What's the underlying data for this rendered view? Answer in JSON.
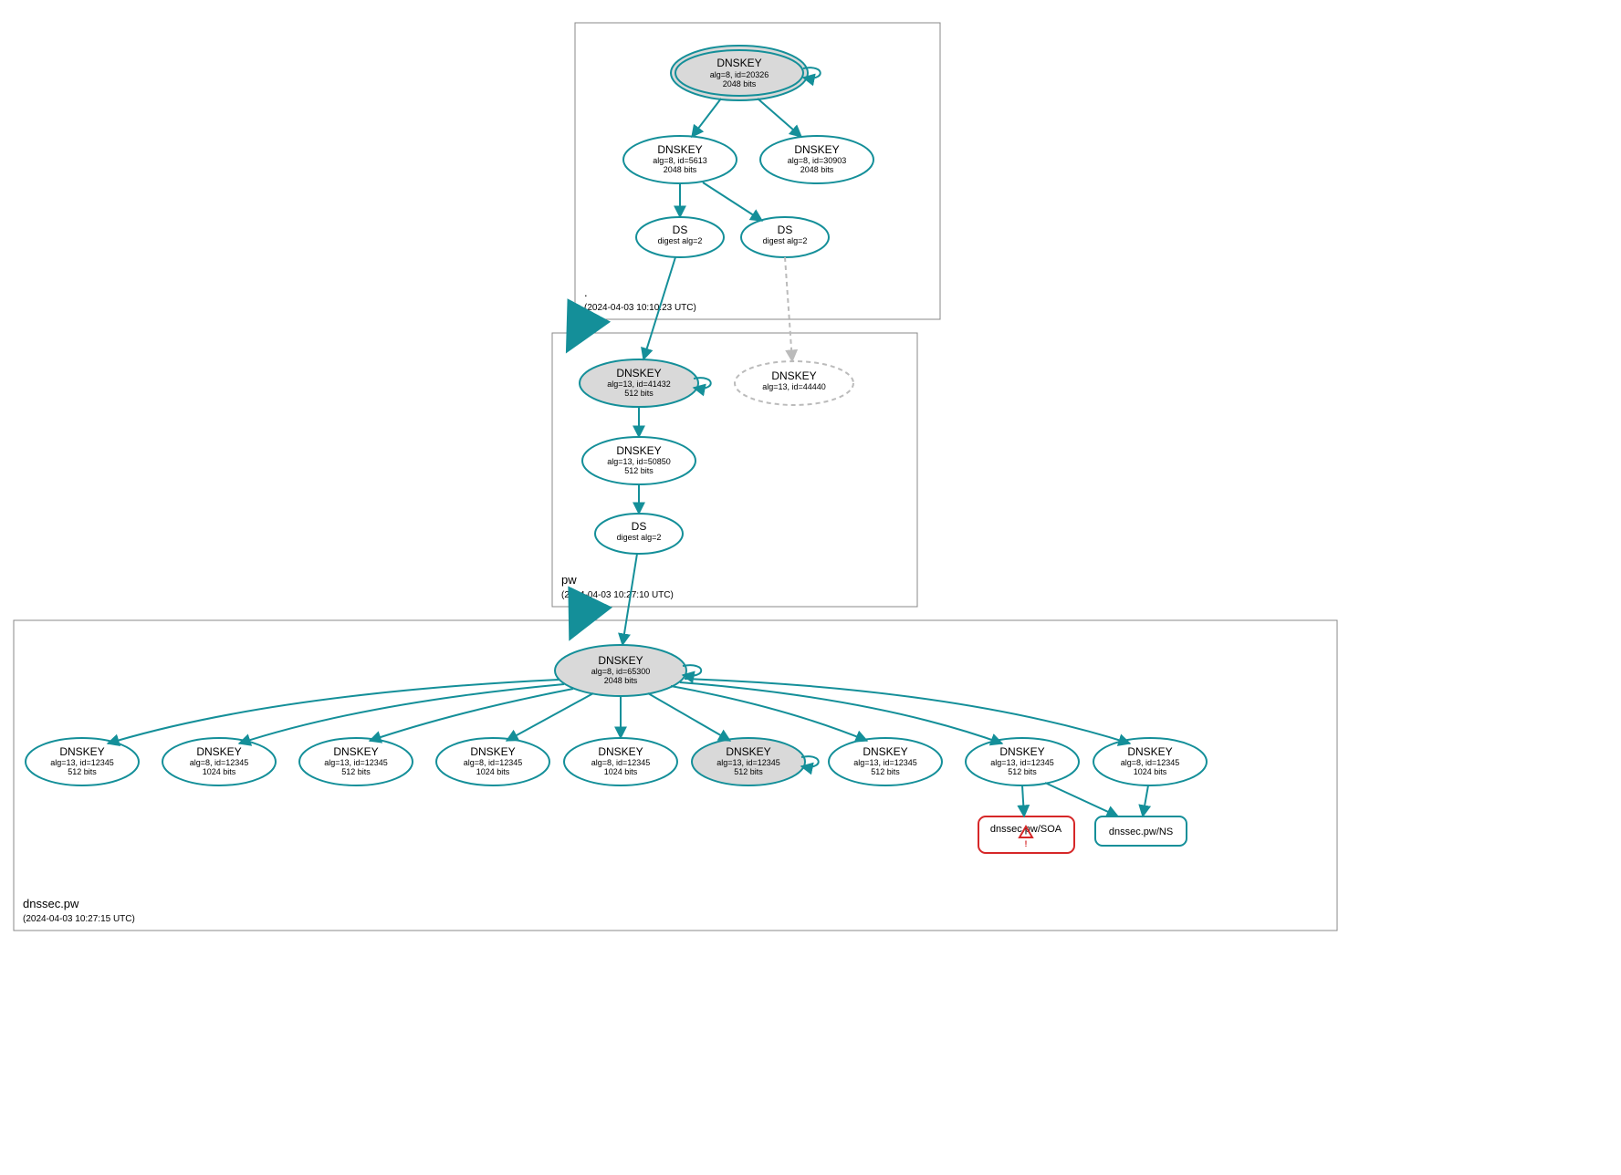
{
  "zones": {
    "root": {
      "label": ".",
      "time": "(2024-04-03 10:10:23 UTC)"
    },
    "pw": {
      "label": "pw",
      "time": "(2024-04-03 10:27:10 UTC)"
    },
    "dnssec": {
      "label": "dnssec.pw",
      "time": "(2024-04-03 10:27:15 UTC)"
    }
  },
  "root": {
    "ksk": {
      "t": "DNSKEY",
      "s1": "alg=8, id=20326",
      "s2": "2048 bits"
    },
    "zsk1": {
      "t": "DNSKEY",
      "s1": "alg=8, id=5613",
      "s2": "2048 bits"
    },
    "zsk2": {
      "t": "DNSKEY",
      "s1": "alg=8, id=30903",
      "s2": "2048 bits"
    },
    "ds1": {
      "t": "DS",
      "s1": "digest alg=2"
    },
    "ds2": {
      "t": "DS",
      "s1": "digest alg=2"
    }
  },
  "pw": {
    "ksk": {
      "t": "DNSKEY",
      "s1": "alg=13, id=41432",
      "s2": "512 bits"
    },
    "missing": {
      "t": "DNSKEY",
      "s1": "alg=13, id=44440"
    },
    "zsk": {
      "t": "DNSKEY",
      "s1": "alg=13, id=50850",
      "s2": "512 bits"
    },
    "ds": {
      "t": "DS",
      "s1": "digest alg=2"
    }
  },
  "dnssec": {
    "ksk": {
      "t": "DNSKEY",
      "s1": "alg=8, id=65300",
      "s2": "2048 bits"
    },
    "k1": {
      "t": "DNSKEY",
      "s1": "alg=13, id=12345",
      "s2": "512 bits"
    },
    "k2": {
      "t": "DNSKEY",
      "s1": "alg=8, id=12345",
      "s2": "1024 bits"
    },
    "k3": {
      "t": "DNSKEY",
      "s1": "alg=13, id=12345",
      "s2": "512 bits"
    },
    "k4": {
      "t": "DNSKEY",
      "s1": "alg=8, id=12345",
      "s2": "1024 bits"
    },
    "k5": {
      "t": "DNSKEY",
      "s1": "alg=8, id=12345",
      "s2": "1024 bits"
    },
    "k6": {
      "t": "DNSKEY",
      "s1": "alg=13, id=12345",
      "s2": "512 bits"
    },
    "k7": {
      "t": "DNSKEY",
      "s1": "alg=13, id=12345",
      "s2": "512 bits"
    },
    "k8": {
      "t": "DNSKEY",
      "s1": "alg=13, id=12345",
      "s2": "512 bits"
    },
    "k9": {
      "t": "DNSKEY",
      "s1": "alg=8, id=12345",
      "s2": "1024 bits"
    }
  },
  "rr": {
    "soa": "dnssec.pw/SOA",
    "ns": "dnssec.pw/NS"
  }
}
